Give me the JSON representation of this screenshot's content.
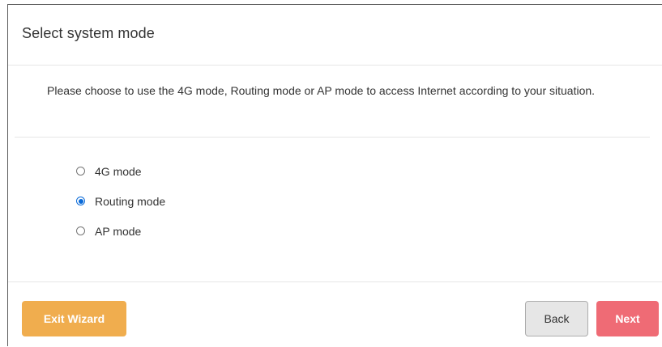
{
  "dialog": {
    "title": "Select system mode",
    "description": "Please choose to use the 4G mode, Routing mode or AP mode to access Internet according to your situation.",
    "options": [
      {
        "label": "4G mode",
        "checked": false
      },
      {
        "label": "Routing mode",
        "checked": true
      },
      {
        "label": "AP mode",
        "checked": false
      }
    ]
  },
  "footer": {
    "exit_label": "Exit Wizard",
    "back_label": "Back",
    "next_label": "Next"
  },
  "colors": {
    "exit_button": "#f0ad4e",
    "next_button": "#ef6b75",
    "back_button": "#e6e6e6",
    "radio_checked": "#0a6ad8"
  }
}
